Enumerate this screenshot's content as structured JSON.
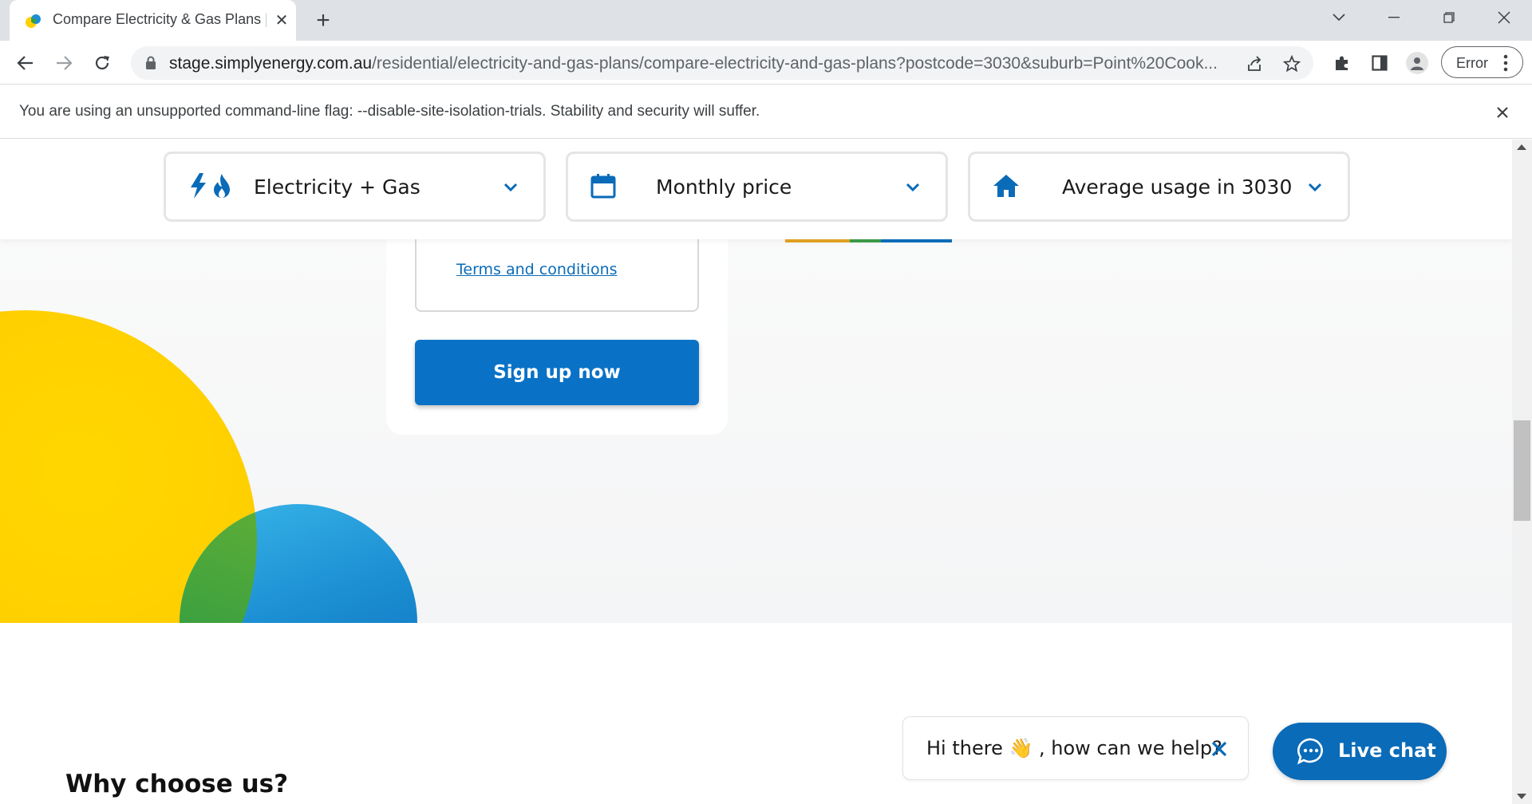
{
  "browser": {
    "tab_title": "Compare Electricity & Gas Plans | Simply Energy",
    "url_host": "stage.simplyenergy.com.au",
    "url_path": "/residential/electricity-and-gas-plans/compare-electricity-and-gas-plans?postcode=3030&suburb=Point%20Cook...",
    "error_label": "Error",
    "infobar_text": "You are using an unsupported command-line flag: --disable-site-isolation-trials. Stability and security will suffer."
  },
  "selectors": [
    {
      "label": "Electricity + Gas",
      "icon": "electricity-gas-icon"
    },
    {
      "label": "Monthly price",
      "icon": "calendar-icon"
    },
    {
      "label": "Average usage in 3030",
      "icon": "home-icon"
    }
  ],
  "plan_card": {
    "terms_link": "Terms and conditions",
    "signup_button": "Sign up now"
  },
  "section": {
    "why_title": "Why choose us?"
  },
  "chat": {
    "greeting_prefix": "Hi there",
    "greeting_emoji": "👋",
    "greeting_suffix": ", how can we help?",
    "livechat_label": "Live chat"
  },
  "colors": {
    "brand_blue": "#0a6bb8",
    "button_blue": "#0a72c6",
    "sun_yellow": "#ffd000",
    "sun_orange": "#f7931e",
    "green": "#3aa040",
    "tab_underline": [
      "#e0a020",
      "#3a9a45",
      "#0a6bb8"
    ]
  }
}
